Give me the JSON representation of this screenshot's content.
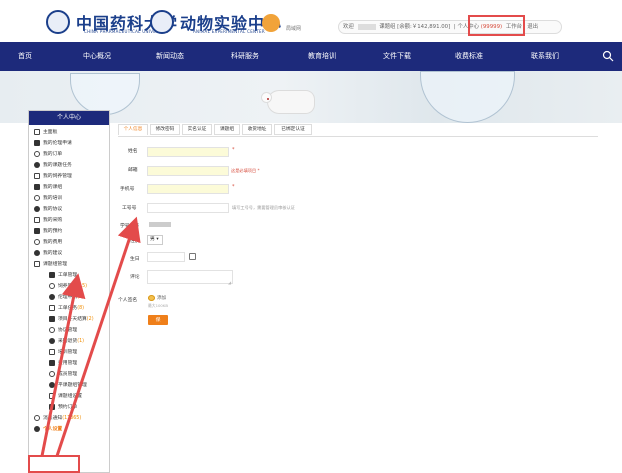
{
  "header": {
    "brand_left": "中国药科大学",
    "brand_left_sub": "CHINA PHARMACEUTICAL UNIVERSITY",
    "brand_right": "动物实验中心",
    "brand_right_sub": "ANIMAL EXPERIMENTAL CENTER",
    "small_link": "局域网",
    "topbar": {
      "welcome": "欢迎",
      "balance_text": "课题组 [余额:￥142,891.00]",
      "personal_center": "个人中心",
      "badge": "(99999)",
      "workbench": "工作台",
      "logout": "退出",
      "separator": "|"
    }
  },
  "nav": {
    "items": [
      "首页",
      "中心概况",
      "新闻动态",
      "科研服务",
      "教育培训",
      "文件下载",
      "收费标准",
      "联系我们"
    ]
  },
  "sidebar": {
    "title": "个人中心",
    "items": [
      {
        "label": "主面板",
        "icon": "home-icon",
        "level": 0
      },
      {
        "label": "我的伦理申请",
        "icon": "heart-icon",
        "level": 0
      },
      {
        "label": "我的订单",
        "icon": "list-icon",
        "level": 0
      },
      {
        "label": "我的课题任务",
        "icon": "check-icon",
        "level": 0
      },
      {
        "label": "我的饲养管理",
        "icon": "gear-icon",
        "level": 0
      },
      {
        "label": "我的课组",
        "icon": "group-icon",
        "level": 0
      },
      {
        "label": "我的培训",
        "icon": "book-icon",
        "level": 0
      },
      {
        "label": "我的协议",
        "icon": "doc-icon",
        "level": 0
      },
      {
        "label": "我的采购",
        "icon": "bag-icon",
        "level": 0
      },
      {
        "label": "我的预约",
        "icon": "clock-icon",
        "level": 0
      },
      {
        "label": "我的费用",
        "icon": "money-icon",
        "level": 0
      },
      {
        "label": "我的建议",
        "icon": "edit-icon",
        "level": 0
      },
      {
        "label": "课题组管理",
        "icon": "team-icon",
        "level": 0
      },
      {
        "label": "工单管理",
        "icon": "list-icon",
        "level": 1
      },
      {
        "label": "饲养管理",
        "count": "(15)",
        "icon": "gear-icon",
        "level": 1
      },
      {
        "label": "伦理申请",
        "count": "(2)",
        "icon": "heart-icon",
        "level": 1
      },
      {
        "label": "工单任务",
        "count": "(8)",
        "icon": "check-icon",
        "level": 1
      },
      {
        "label": "项目冬天结算",
        "count": "(2)",
        "icon": "bar-icon",
        "level": 1
      },
      {
        "label": "协议管理",
        "icon": "doc-icon",
        "level": 1
      },
      {
        "label": "采购退货",
        "count": "(1)",
        "icon": "box-icon",
        "level": 1
      },
      {
        "label": "培训管理",
        "icon": "book-icon",
        "level": 1
      },
      {
        "label": "费用管理",
        "icon": "money-icon",
        "level": 1
      },
      {
        "label": "成员管理",
        "icon": "user-icon",
        "level": 1
      },
      {
        "label": "平课题组管理",
        "icon": "table-icon",
        "level": 1
      },
      {
        "label": "课题组设置",
        "icon": "gear-icon",
        "level": 1
      },
      {
        "label": "预约订单",
        "icon": "clock-icon",
        "level": 1
      },
      {
        "label": "消息通知",
        "count": "(11365)",
        "icon": "mail-icon",
        "level": 0
      },
      {
        "label": "个人设置",
        "icon": "gear-icon",
        "level": 0,
        "selected": true
      }
    ]
  },
  "tabs": [
    "个人信息",
    "修改密码",
    "实名认证",
    "课题组",
    "收货地址",
    "已绑定认证"
  ],
  "form": {
    "labels": {
      "name": "姓名",
      "email": "邮箱",
      "phone": "手机号",
      "work_id": "工号号",
      "student_id": "学号学号",
      "gender": "性别",
      "birthday": "生日",
      "bio": "评论",
      "signature": "个人签名"
    },
    "required_mark": "*",
    "email_hint": "这是必填项目 *",
    "work_hint": "填写工号号，需要管理员审核认证",
    "gender_value": "男",
    "gender_arrow": "▾",
    "upload_label": "添加",
    "upload_sub": "最大100KB",
    "save_button": "保存"
  },
  "colors": {
    "nav_bg": "#1d2a7b",
    "accent": "#ef7f1a",
    "highlight_box": "#e34b4b",
    "yellow_field": "#fcfbd8"
  }
}
